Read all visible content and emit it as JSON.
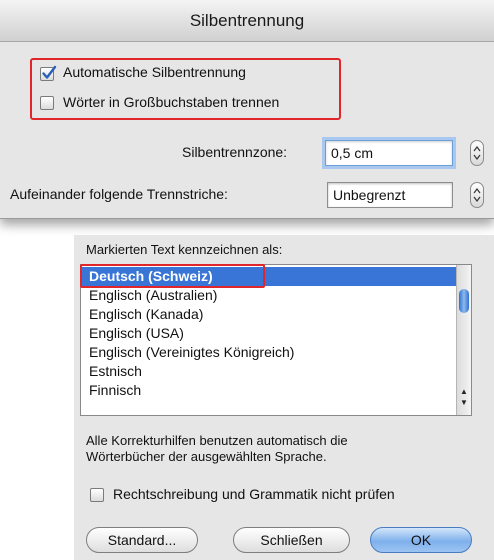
{
  "hyphenation": {
    "title": "Silbentrennung",
    "auto_label": "Automatische Silbentrennung",
    "auto_checked": true,
    "caps_label": "Wörter in Großbuchstaben trennen",
    "caps_checked": false,
    "zone_label": "Silbentrennzone:",
    "zone_value": "0,5 cm",
    "consecutive_label": "Aufeinander folgende Trennstriche:",
    "consecutive_value": "Unbegrenzt"
  },
  "language": {
    "header": "Markierten Text kennzeichnen als:",
    "items": [
      "Deutsch (Schweiz)",
      "Englisch (Australien)",
      "Englisch (Kanada)",
      "Englisch (USA)",
      "Englisch (Vereinigtes Königreich)",
      "Estnisch",
      "Finnisch"
    ],
    "selected_index": 0,
    "info_text_line1": "Alle Korrekturhilfen benutzen automatisch die",
    "info_text_line2": "Wörterbücher der ausgewählten Sprache.",
    "skip_check_label": "Rechtschreibung und Grammatik nicht prüfen",
    "skip_check_checked": false,
    "buttons": {
      "standard": "Standard...",
      "close": "Schließen",
      "ok": "OK"
    }
  },
  "colors": {
    "selection": "#3875d7",
    "highlight_box": "#e0262b",
    "check_mark": "#2a5fb8"
  }
}
